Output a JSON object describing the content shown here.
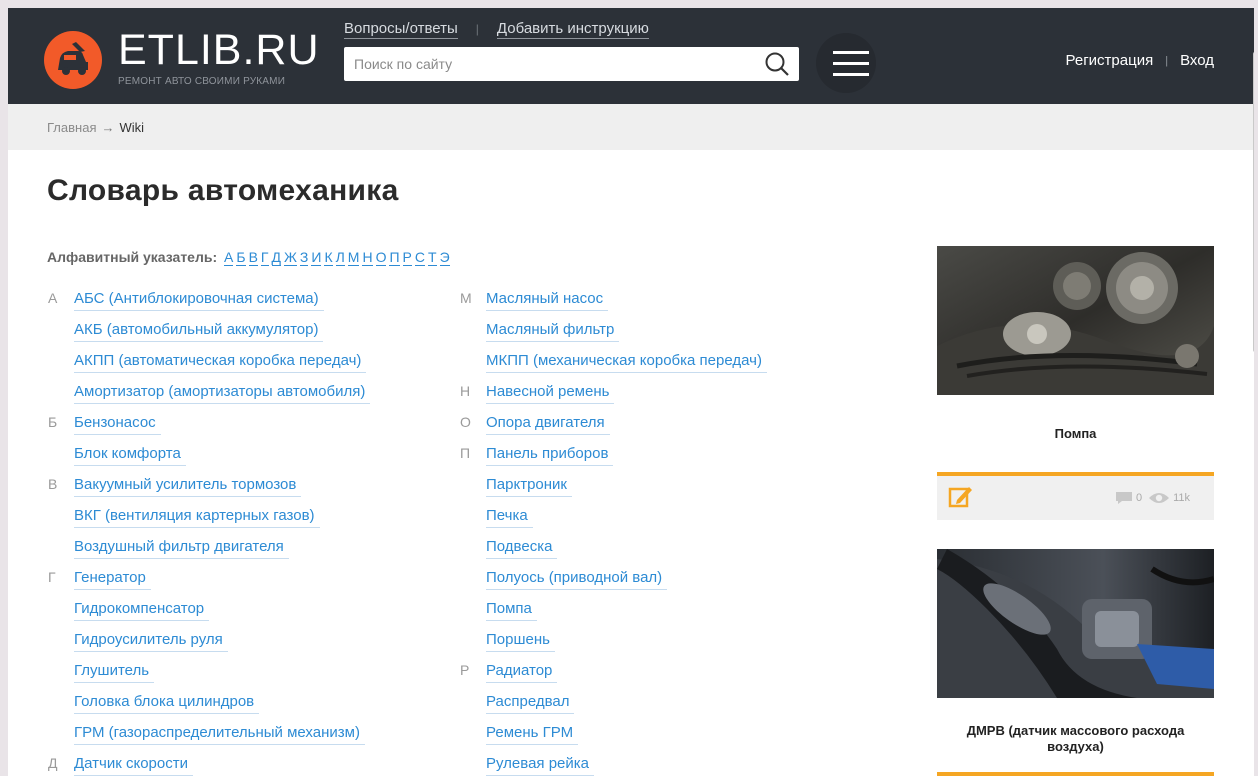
{
  "header": {
    "logo_text": "ETLIB.RU",
    "logo_tagline": "РЕМОНТ АВТО СВОИМИ РУКАМИ",
    "links": [
      "Вопросы/ответы",
      "Добавить инструкцию"
    ],
    "search_placeholder": "Поиск по сайту",
    "auth": {
      "register": "Регистрация",
      "login": "Вход"
    }
  },
  "breadcrumb": {
    "home": "Главная",
    "arrow": "→",
    "current": "Wiki"
  },
  "page_title": "Словарь автомеханика",
  "alphabet": {
    "label": "Алфавитный указатель:",
    "letters": [
      "А",
      "Б",
      "В",
      "Г",
      "Д",
      "Ж",
      "З",
      "И",
      "К",
      "Л",
      "М",
      "Н",
      "О",
      "П",
      "Р",
      "С",
      "Т",
      "Э"
    ]
  },
  "left_column": [
    {
      "letter": "А",
      "term": "АБС (Антиблокировочная система)"
    },
    {
      "letter": "",
      "term": "АКБ (автомобильный аккумулятор)"
    },
    {
      "letter": "",
      "term": "АКПП (автоматическая коробка передач)"
    },
    {
      "letter": "",
      "term": "Амортизатор (амортизаторы автомобиля)"
    },
    {
      "letter": "Б",
      "term": "Бензонасос"
    },
    {
      "letter": "",
      "term": "Блок комфорта"
    },
    {
      "letter": "В",
      "term": "Вакуумный усилитель тормозов"
    },
    {
      "letter": "",
      "term": "ВКГ (вентиляция картерных газов)"
    },
    {
      "letter": "",
      "term": "Воздушный фильтр двигателя"
    },
    {
      "letter": "Г",
      "term": "Генератор"
    },
    {
      "letter": "",
      "term": "Гидрокомпенсатор"
    },
    {
      "letter": "",
      "term": "Гидроусилитель руля"
    },
    {
      "letter": "",
      "term": "Глушитель"
    },
    {
      "letter": "",
      "term": "Головка блока цилиндров"
    },
    {
      "letter": "",
      "term": "ГРМ (газораспределительный механизм)"
    },
    {
      "letter": "Д",
      "term": "Датчик скорости"
    }
  ],
  "middle_column": [
    {
      "letter": "М",
      "term": "Масляный насос"
    },
    {
      "letter": "",
      "term": "Масляный фильтр"
    },
    {
      "letter": "",
      "term": "МКПП (механическая коробка передач)"
    },
    {
      "letter": "Н",
      "term": "Навесной ремень"
    },
    {
      "letter": "О",
      "term": "Опора двигателя"
    },
    {
      "letter": "П",
      "term": "Панель приборов"
    },
    {
      "letter": "",
      "term": "Парктроник"
    },
    {
      "letter": "",
      "term": "Печка"
    },
    {
      "letter": "",
      "term": "Подвеска"
    },
    {
      "letter": "",
      "term": "Полуось (приводной вал)"
    },
    {
      "letter": "",
      "term": "Помпа"
    },
    {
      "letter": "",
      "term": "Поршень"
    },
    {
      "letter": "Р",
      "term": "Радиатор"
    },
    {
      "letter": "",
      "term": "Распредвал"
    },
    {
      "letter": "",
      "term": "Ремень ГРМ"
    },
    {
      "letter": "",
      "term": "Рулевая рейка"
    }
  ],
  "sidebar": {
    "card1": {
      "title": "Помпа",
      "comments": "0",
      "views": "11k",
      "image": "water-pump-photo"
    },
    "card2": {
      "title": "ДМРВ (датчик массового расхода воздуха)",
      "image": "air-flow-sensor-photo"
    }
  },
  "colors": {
    "header_bg": "#2c3138",
    "accent": "#f25a29",
    "link": "#2d8bd4",
    "card_bar": "#f5a623"
  }
}
